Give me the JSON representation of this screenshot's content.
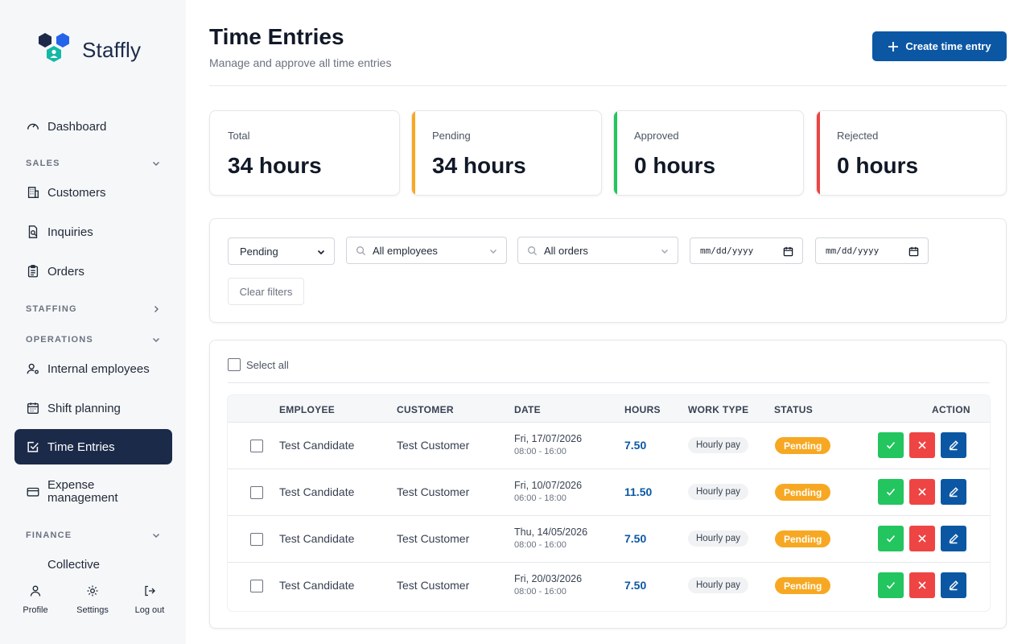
{
  "app": {
    "name": "Staffly"
  },
  "colors": {
    "primary": "#0b57a4",
    "sidebar_active": "#1c2a4a",
    "pending": "#f7a823",
    "approved": "#22c55e",
    "rejected": "#ef4444"
  },
  "sidebar": {
    "dashboard": {
      "label": "Dashboard",
      "icon": "gauge-icon"
    },
    "sections": {
      "sales": "SALES",
      "staffing": "STAFFING",
      "operations": "OPERATIONS",
      "finance": "FINANCE"
    },
    "customers": {
      "label": "Customers",
      "icon": "building-icon"
    },
    "inquiries": {
      "label": "Inquiries",
      "icon": "file-search-icon"
    },
    "orders": {
      "label": "Orders",
      "icon": "clipboard-icon"
    },
    "internal_employees": {
      "label": "Internal employees",
      "icon": "user-cog-icon"
    },
    "shift_planning": {
      "label": "Shift planning",
      "icon": "calendar-icon"
    },
    "time_entries": {
      "label": "Time Entries",
      "icon": "check-square-icon"
    },
    "expense_management": {
      "label": "Expense management",
      "icon": "credit-card-icon"
    },
    "collective": {
      "label": "Collective",
      "icon": "document-icon"
    }
  },
  "bottom": {
    "profile": "Profile",
    "settings": "Settings",
    "logout": "Log out"
  },
  "header": {
    "title": "Time Entries",
    "subtitle": "Manage and approve all time entries",
    "create_label": "Create time entry"
  },
  "stats": {
    "total": {
      "label": "Total",
      "value": "34 hours"
    },
    "pending": {
      "label": "Pending",
      "value": "34 hours"
    },
    "approved": {
      "label": "Approved",
      "value": "0 hours"
    },
    "rejected": {
      "label": "Rejected",
      "value": "0 hours"
    }
  },
  "filters": {
    "status_value": "Pending",
    "employee_value": "All employees",
    "order_value": "All orders",
    "date_from": "mm/dd/yyyy",
    "date_to": "mm/dd/yyyy",
    "clear_label": "Clear filters"
  },
  "table": {
    "select_all": "Select all",
    "columns": {
      "employee": "EMPLOYEE",
      "customer": "CUSTOMER",
      "date": "DATE",
      "hours": "HOURS",
      "work_type": "WORK TYPE",
      "status": "STATUS",
      "action": "ACTION"
    },
    "rows": [
      {
        "employee": "Test Candidate",
        "customer": "Test Customer",
        "date": "Fri, 17/07/2026",
        "time": "08:00 - 16:00",
        "hours": "7.50",
        "work_type": "Hourly pay",
        "status": "Pending"
      },
      {
        "employee": "Test Candidate",
        "customer": "Test Customer",
        "date": "Fri, 10/07/2026",
        "time": "06:00 - 18:00",
        "hours": "11.50",
        "work_type": "Hourly pay",
        "status": "Pending"
      },
      {
        "employee": "Test Candidate",
        "customer": "Test Customer",
        "date": "Thu, 14/05/2026",
        "time": "08:00 - 16:00",
        "hours": "7.50",
        "work_type": "Hourly pay",
        "status": "Pending"
      },
      {
        "employee": "Test Candidate",
        "customer": "Test Customer",
        "date": "Fri, 20/03/2026",
        "time": "08:00 - 16:00",
        "hours": "7.50",
        "work_type": "Hourly pay",
        "status": "Pending"
      }
    ]
  }
}
